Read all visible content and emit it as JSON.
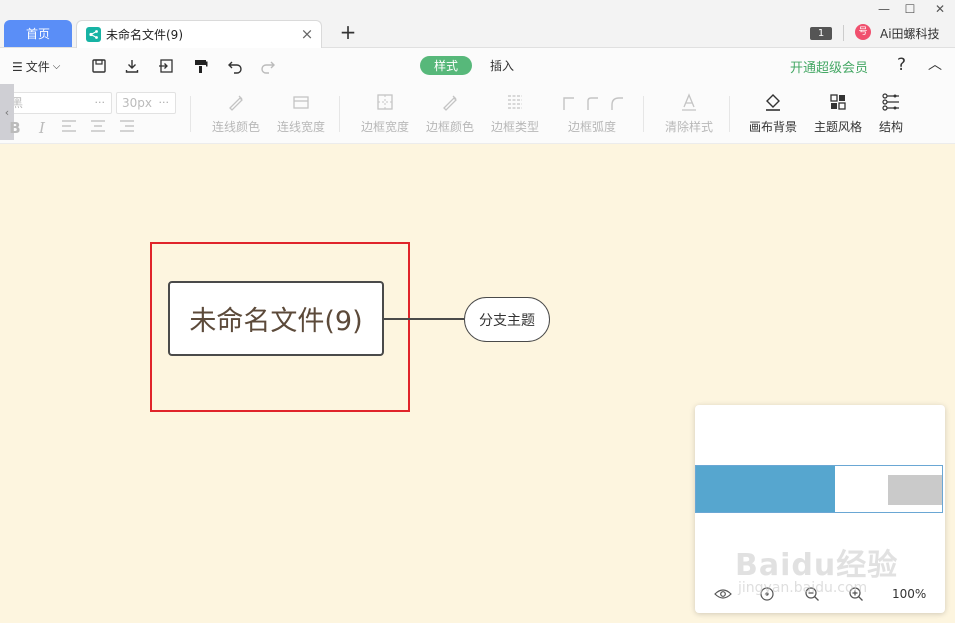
{
  "tabs": {
    "home_label": "首页",
    "doc_title": "未命名文件(9)",
    "close_symbol": "×",
    "add_symbol": "+"
  },
  "window_controls": {
    "minimize": "—",
    "maximize": "☐",
    "close": "✕"
  },
  "account": {
    "badge": "1",
    "avatar_text": "号",
    "name": "Ai田螺科技"
  },
  "menu": {
    "file_label": "文件",
    "mode_tabs": [
      "样式",
      "插入"
    ],
    "vip_link": "开通超级会员",
    "help": "?",
    "collapse": "︿"
  },
  "toolbar": {
    "font_family": "黑",
    "font_size": "30px",
    "more": "···",
    "tools": [
      {
        "label": "连线颜色",
        "icon": "pen-icon",
        "enabled": false
      },
      {
        "label": "连线宽度",
        "icon": "line-width-icon",
        "enabled": false
      },
      {
        "label": "边框宽度",
        "icon": "border-width-icon",
        "enabled": false
      },
      {
        "label": "边框颜色",
        "icon": "pen-icon",
        "enabled": false
      },
      {
        "label": "边框类型",
        "icon": "border-type-icon",
        "enabled": false
      },
      {
        "label": "边框弧度",
        "icon": "corner-radius-icon",
        "enabled": false
      },
      {
        "label": "清除样式",
        "icon": "clear-style-icon",
        "enabled": false
      },
      {
        "label": "画布背景",
        "icon": "paint-bucket-icon",
        "enabled": true
      },
      {
        "label": "主题风格",
        "icon": "theme-icon",
        "enabled": true
      },
      {
        "label": "结构",
        "icon": "structure-icon",
        "enabled": true
      }
    ]
  },
  "canvas": {
    "root_topic": "未命名文件(9)",
    "branch_topic": "分支主题"
  },
  "minimap": {
    "zoom": "100%",
    "watermark": "Baidu经验",
    "watermark_sub": "jingyan.baidu.com"
  },
  "colors": {
    "accent_green": "#57b87a",
    "home_tab_blue": "#5a8ef7",
    "canvas_bg": "#fdf5df",
    "selection_red": "#e0242a",
    "minimap_root": "#56a6cf"
  }
}
